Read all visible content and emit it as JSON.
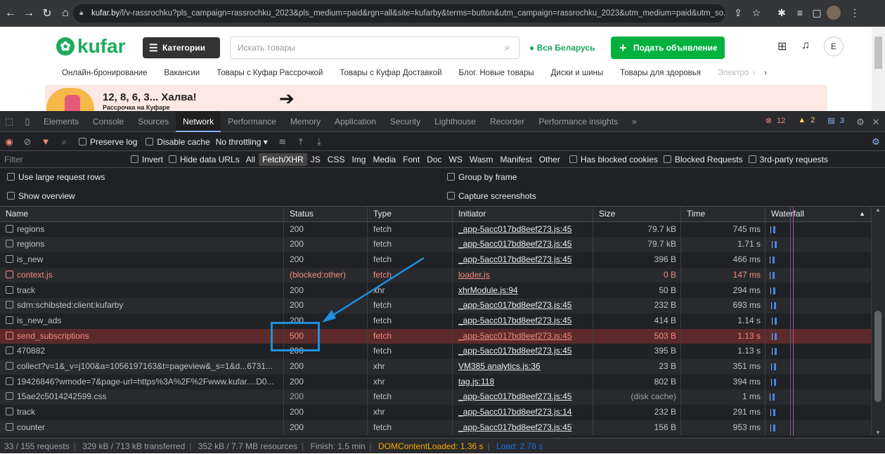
{
  "browser": {
    "url_host": "kufar.by",
    "url_rest": "/l/v-rassrochku?pls_campaign=rassrochku_2023&pls_medium=paid&rgn=all&site=kufarby&terms=button&utm_campaign=rassrochku_2023&utm_medium=paid&utm_so..."
  },
  "site": {
    "logo": "kufar",
    "categories_btn": "Категории",
    "search_placeholder": "Искать товары",
    "region": "Вся Беларусь",
    "post_btn": "Подать объявление",
    "avatar": "E",
    "nav": [
      "Онлайн-бронирование",
      "Вакансии",
      "Товары с Куфар Рассрочкой",
      "Товары с Куфар Доставкой",
      "Блог. Новые товары",
      "Диски и шины",
      "Товары для здоровья",
      "Электро"
    ],
    "banner_title": "12, 8, 6, 3... Халва!",
    "banner_sub": "Рассрочка на Куфаре"
  },
  "devtools": {
    "tabs": [
      "Elements",
      "Console",
      "Sources",
      "Network",
      "Performance",
      "Memory",
      "Application",
      "Security",
      "Lighthouse",
      "Recorder",
      "Performance insights"
    ],
    "active_tab": "Network",
    "badges": {
      "errors": "12",
      "warnings": "2",
      "info": "3"
    },
    "toolbar": {
      "preserve_log": "Preserve log",
      "disable_cache": "Disable cache",
      "throttling": "No throttling"
    },
    "filter": {
      "placeholder": "Filter",
      "invert": "Invert",
      "hide_data": "Hide data URLs",
      "types": [
        "All",
        "Fetch/XHR",
        "JS",
        "CSS",
        "Img",
        "Media",
        "Font",
        "Doc",
        "WS",
        "Wasm",
        "Manifest",
        "Other"
      ],
      "selected_type": "Fetch/XHR",
      "blocked_cookies": "Has blocked cookies",
      "blocked_requests": "Blocked Requests",
      "third_party": "3rd-party requests"
    },
    "options": {
      "large_rows": "Use large request rows",
      "group_frame": "Group by frame",
      "overview": "Show overview",
      "screenshots": "Capture screenshots"
    },
    "columns": {
      "name": "Name",
      "status": "Status",
      "type": "Type",
      "initiator": "Initiator",
      "size": "Size",
      "time": "Time",
      "waterfall": "Waterfall"
    },
    "rows": [
      {
        "name": "regions",
        "status": "200",
        "type": "fetch",
        "initiator": "_app-5acc017bd8eef273.js:45",
        "size": "79.7 kB",
        "time": "745 ms",
        "state": "ok"
      },
      {
        "name": "regions",
        "status": "200",
        "type": "fetch",
        "initiator": "_app-5acc017bd8eef273.js:45",
        "size": "79.7 kB",
        "time": "1.71 s",
        "state": "ok"
      },
      {
        "name": "is_new",
        "status": "200",
        "type": "fetch",
        "initiator": "_app-5acc017bd8eef273.js:45",
        "size": "396 B",
        "time": "466 ms",
        "state": "ok"
      },
      {
        "name": "context.js",
        "status": "(blocked:other)",
        "type": "fetch",
        "initiator": "loader.js",
        "size": "0 B",
        "time": "147 ms",
        "state": "err"
      },
      {
        "name": "track",
        "status": "200",
        "type": "xhr",
        "initiator": "xhrModule.js:94",
        "size": "50 B",
        "time": "294 ms",
        "state": "ok"
      },
      {
        "name": "sdrn:schibsted:client:kufarby",
        "status": "200",
        "type": "fetch",
        "initiator": "_app-5acc017bd8eef273.js:45",
        "size": "232 B",
        "time": "693 ms",
        "state": "ok"
      },
      {
        "name": "is_new_ads",
        "status": "200",
        "type": "fetch",
        "initiator": "_app-5acc017bd8eef273.js:45",
        "size": "414 B",
        "time": "1.14 s",
        "state": "ok"
      },
      {
        "name": "send_subscriptions",
        "status": "500",
        "type": "fetch",
        "initiator": "_app-5acc017bd8eef273.js:45",
        "size": "503 B",
        "time": "1.13 s",
        "state": "errsel"
      },
      {
        "name": "470882",
        "status": "200",
        "type": "fetch",
        "initiator": "_app-5acc017bd8eef273.js:45",
        "size": "395 B",
        "time": "1.13 s",
        "state": "ok"
      },
      {
        "name": "collect?v=1&_v=j100&a=1056197163&t=pageview&_s=1&d...6731...",
        "status": "200",
        "type": "xhr",
        "initiator": "VM385 analytics.js:36",
        "size": "23 B",
        "time": "351 ms",
        "state": "ok"
      },
      {
        "name": "19426846?wmode=7&page-url=https%3A%2F%2Fwww.kufar....D0...",
        "status": "200",
        "type": "xhr",
        "initiator": "tag.js:118",
        "size": "802 B",
        "time": "394 ms",
        "state": "ok"
      },
      {
        "name": "15ae2c5014242599.css",
        "status": "200",
        "type": "fetch",
        "initiator": "_app-5acc017bd8eef273.js:45",
        "size": "(disk cache)",
        "time": "1 ms",
        "state": "ok"
      },
      {
        "name": "track",
        "status": "200",
        "type": "xhr",
        "initiator": "_app-5acc017bd8eef273.js:14",
        "size": "232 B",
        "time": "291 ms",
        "state": "ok"
      },
      {
        "name": "counter",
        "status": "200",
        "type": "fetch",
        "initiator": "_app-5acc017bd8eef273.js:45",
        "size": "156 B",
        "time": "953 ms",
        "state": "ok"
      }
    ],
    "status_bar": {
      "requests": "33 / 155 requests",
      "transferred": "329 kB / 713 kB transferred",
      "resources": "352 kB / 7.7 MB resources",
      "finish": "Finish: 1.5 min",
      "dcl": "DOMContentLoaded: 1.36 s",
      "load": "Load: 2.78 s"
    }
  }
}
